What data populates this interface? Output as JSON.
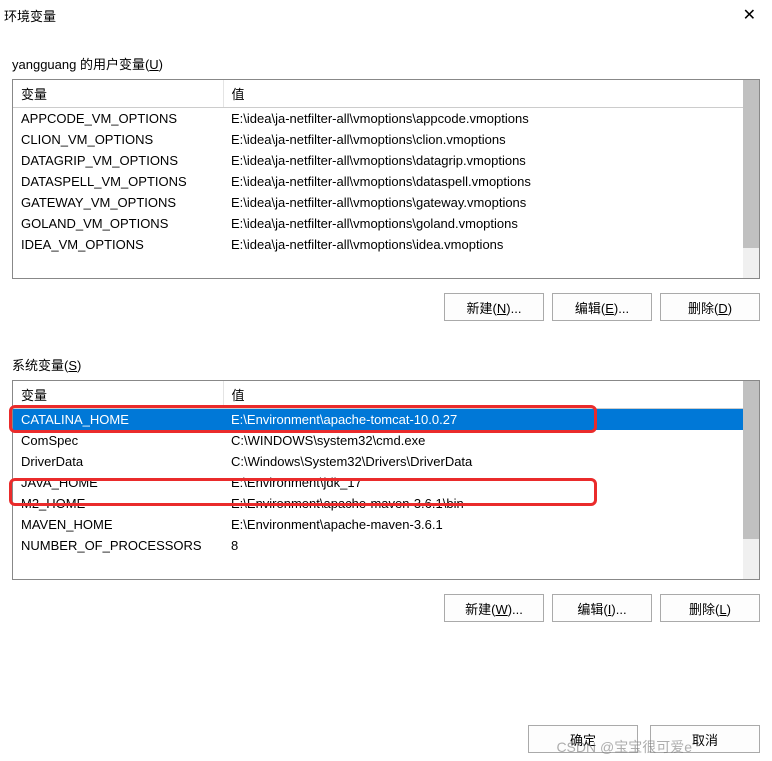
{
  "titlebar": {
    "title": "环境变量"
  },
  "user_section": {
    "label_prefix": "yangguang 的用户变量(",
    "label_key": "U",
    "label_suffix": ")",
    "headers": {
      "var": "变量",
      "val": "值"
    },
    "rows": [
      {
        "var": "APPCODE_VM_OPTIONS",
        "val": "E:\\idea\\ja-netfilter-all\\vmoptions\\appcode.vmoptions"
      },
      {
        "var": "CLION_VM_OPTIONS",
        "val": "E:\\idea\\ja-netfilter-all\\vmoptions\\clion.vmoptions"
      },
      {
        "var": "DATAGRIP_VM_OPTIONS",
        "val": "E:\\idea\\ja-netfilter-all\\vmoptions\\datagrip.vmoptions"
      },
      {
        "var": "DATASPELL_VM_OPTIONS",
        "val": "E:\\idea\\ja-netfilter-all\\vmoptions\\dataspell.vmoptions"
      },
      {
        "var": "GATEWAY_VM_OPTIONS",
        "val": "E:\\idea\\ja-netfilter-all\\vmoptions\\gateway.vmoptions"
      },
      {
        "var": "GOLAND_VM_OPTIONS",
        "val": "E:\\idea\\ja-netfilter-all\\vmoptions\\goland.vmoptions"
      },
      {
        "var": "IDEA_VM_OPTIONS",
        "val": "E:\\idea\\ja-netfilter-all\\vmoptions\\idea.vmoptions"
      }
    ],
    "buttons": {
      "new_prefix": "新建(",
      "new_key": "N",
      "new_suffix": ")...",
      "edit_prefix": "编辑(",
      "edit_key": "E",
      "edit_suffix": ")...",
      "del_prefix": "删除(",
      "del_key": "D",
      "del_suffix": ")"
    }
  },
  "sys_section": {
    "label_prefix": "系统变量(",
    "label_key": "S",
    "label_suffix": ")",
    "headers": {
      "var": "变量",
      "val": "值"
    },
    "rows": [
      {
        "var": "CATALINA_HOME",
        "val": "E:\\Environment\\apache-tomcat-10.0.27",
        "selected": true
      },
      {
        "var": "ComSpec",
        "val": "C:\\WINDOWS\\system32\\cmd.exe"
      },
      {
        "var": "DriverData",
        "val": "C:\\Windows\\System32\\Drivers\\DriverData"
      },
      {
        "var": "JAVA_HOME",
        "val": "E:\\Environment\\jdk_17"
      },
      {
        "var": "M2_HOME",
        "val": "E:\\Environment\\apache-maven-3.6.1\\bin"
      },
      {
        "var": "MAVEN_HOME",
        "val": "E:\\Environment\\apache-maven-3.6.1"
      },
      {
        "var": "NUMBER_OF_PROCESSORS",
        "val": "8"
      }
    ],
    "buttons": {
      "new_prefix": "新建(",
      "new_key": "W",
      "new_suffix": ")...",
      "edit_prefix": "编辑(",
      "edit_key": "I",
      "edit_suffix": ")...",
      "del_prefix": "删除(",
      "del_key": "L",
      "del_suffix": ")"
    }
  },
  "footer": {
    "ok": "确定",
    "cancel": "取消"
  },
  "watermark": "CSDN @宝宝很可爱e"
}
